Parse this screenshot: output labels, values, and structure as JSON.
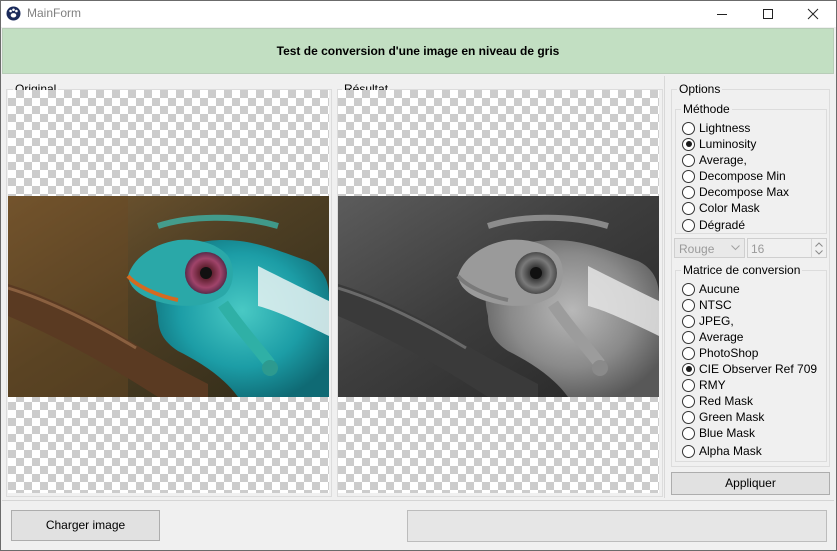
{
  "window": {
    "title": "MainForm"
  },
  "header": {
    "title": "Test de conversion d'une image en niveau de gris"
  },
  "panels": {
    "original_label": "Original",
    "result_label": "Résultat"
  },
  "options": {
    "label": "Options",
    "method": {
      "label": "Méthode",
      "items": [
        {
          "label": "Lightness",
          "checked": false
        },
        {
          "label": "Luminosity",
          "checked": true
        },
        {
          "label": "Average,",
          "checked": false
        },
        {
          "label": "Decompose Min",
          "checked": false
        },
        {
          "label": "Decompose Max",
          "checked": false
        },
        {
          "label": "Color Mask",
          "checked": false
        },
        {
          "label": "Dégradé",
          "checked": false
        }
      ]
    },
    "channel_select": {
      "value": "Rouge"
    },
    "levels_spin": {
      "value": "16"
    },
    "matrix": {
      "label": "Matrice de conversion",
      "items": [
        {
          "label": "Aucune",
          "checked": false
        },
        {
          "label": "NTSC",
          "checked": false
        },
        {
          "label": "JPEG,",
          "checked": false
        },
        {
          "label": "Average",
          "checked": false
        },
        {
          "label": "PhotoShop",
          "checked": false
        },
        {
          "label": "CIE Observer Ref 709",
          "checked": true
        },
        {
          "label": "RMY",
          "checked": false
        },
        {
          "label": "Red Mask",
          "checked": false
        },
        {
          "label": "Green Mask",
          "checked": false
        },
        {
          "label": "Blue Mask",
          "checked": false
        },
        {
          "label": "Alpha Mask",
          "checked": false
        }
      ]
    },
    "apply_label": "Appliquer"
  },
  "footer": {
    "load_label": "Charger image",
    "progress": 0
  },
  "icons": {
    "app": "paw-icon",
    "minimize": "minimize-icon",
    "maximize": "maximize-icon",
    "close": "close-icon",
    "combo_arrow": "chevron-down-icon",
    "spin_up": "spin-up-icon",
    "spin_down": "spin-down-icon"
  }
}
